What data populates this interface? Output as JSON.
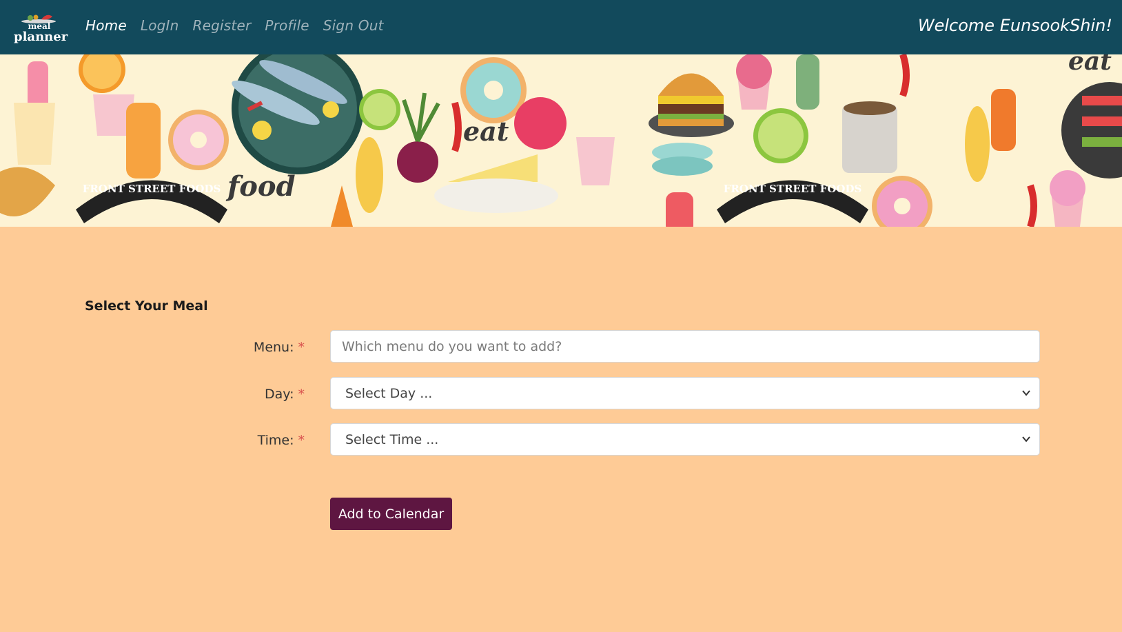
{
  "logo": {
    "line1": "meal",
    "line2": "planner"
  },
  "nav": {
    "items": [
      {
        "label": "Home",
        "active": true
      },
      {
        "label": "LogIn",
        "active": false
      },
      {
        "label": "Register",
        "active": false
      },
      {
        "label": "Profile",
        "active": false
      },
      {
        "label": "Sign Out",
        "active": false
      }
    ],
    "welcome": "Welcome EunsookShin!"
  },
  "banner": {
    "texts": [
      "FRONT STREET FOODS",
      "food",
      "eat",
      "FRONT STREET FOODS",
      "eat"
    ]
  },
  "form": {
    "title": "Select Your Meal",
    "menu": {
      "label": "Menu:",
      "required": "*",
      "placeholder": "Which menu do you want to add?"
    },
    "day": {
      "label": "Day:",
      "required": "*",
      "selected": "Select Day ..."
    },
    "time": {
      "label": "Time:",
      "required": "*",
      "selected": "Select Time ..."
    },
    "submit": "Add to Calendar"
  },
  "colors": {
    "navbar": "#124a5c",
    "background": "#fecb96",
    "button": "#5e1641",
    "required": "#d9534f"
  }
}
